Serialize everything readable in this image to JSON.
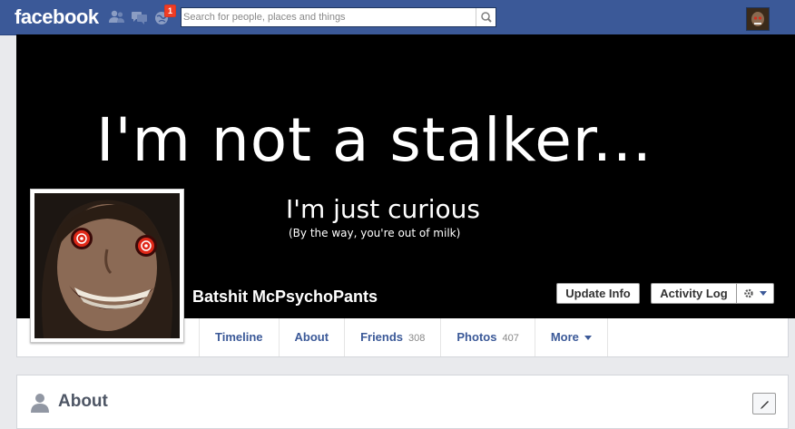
{
  "header": {
    "logo": "facebook",
    "notification_count": "1",
    "search": {
      "placeholder": "Search for people, places and things"
    }
  },
  "cover": {
    "line1": "I'm not a stalker...",
    "line2": "I'm just curious",
    "line3": "(By the way, you're out of milk)"
  },
  "profile": {
    "name": "Batshit McPsychoPants",
    "update_info": "Update Info",
    "activity_log": "Activity Log"
  },
  "tabs": [
    {
      "label": "Timeline",
      "count": ""
    },
    {
      "label": "About",
      "count": ""
    },
    {
      "label": "Friends",
      "count": "308"
    },
    {
      "label": "Photos",
      "count": "407"
    },
    {
      "label": "More",
      "count": ""
    }
  ],
  "about_section": {
    "title": "About"
  },
  "colors": {
    "brand": "#3b5998",
    "link": "#3b5998",
    "background": "#e9eaed",
    "badge": "#f03d25"
  },
  "icons": [
    "friends-icon",
    "messages-icon",
    "notifications-icon",
    "search-icon",
    "gear-icon",
    "person-icon",
    "pencil-icon"
  ]
}
